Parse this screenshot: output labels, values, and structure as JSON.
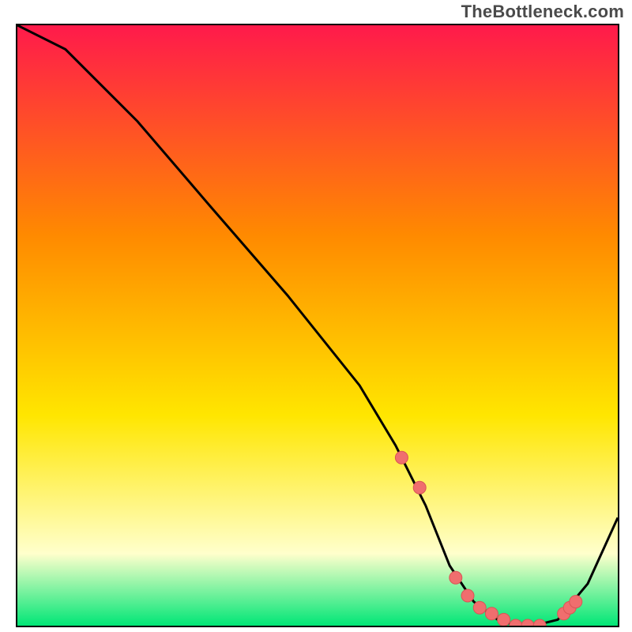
{
  "attribution": "TheBottleneck.com",
  "colors": {
    "gradient_top": "#ff1a4b",
    "gradient_mid1": "#ff8a00",
    "gradient_mid2": "#ffe600",
    "gradient_pale": "#ffffcc",
    "gradient_bottom": "#00e676",
    "curve": "#000000",
    "marker_fill": "#f06e6e",
    "marker_stroke": "#d95555",
    "frame": "#000000"
  },
  "chart_data": {
    "type": "line",
    "title": "",
    "xlabel": "",
    "ylabel": "",
    "xlim": [
      0,
      100
    ],
    "ylim": [
      0,
      100
    ],
    "grid": false,
    "legend": false,
    "series": [
      {
        "name": "bottleneck-curve",
        "x": [
          0,
          8,
          20,
          32,
          45,
          57,
          63,
          68,
          72,
          76,
          80,
          83,
          86,
          90,
          95,
          100
        ],
        "values": [
          100,
          96,
          84,
          70,
          55,
          40,
          30,
          20,
          10,
          4,
          1,
          0,
          0,
          1,
          7,
          18
        ]
      }
    ],
    "markers": {
      "name": "trough-dots",
      "x": [
        64,
        67,
        73,
        75,
        77,
        79,
        81,
        83,
        85,
        87,
        91,
        92,
        93
      ],
      "values": [
        28,
        23,
        8,
        5,
        3,
        2,
        1,
        0,
        0,
        0,
        2,
        3,
        4
      ]
    }
  }
}
